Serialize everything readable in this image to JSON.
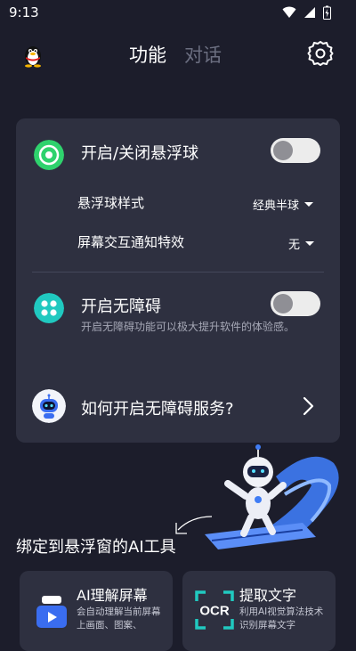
{
  "status_bar": {
    "time": "9:13"
  },
  "header": {
    "tab_active": "功能",
    "tab_inactive": "对话"
  },
  "floating_ball": {
    "title": "开启/关闭悬浮球",
    "enabled": false,
    "style_label": "悬浮球样式",
    "style_value": "经典半球",
    "effect_label": "屏幕交互通知特效",
    "effect_value": "无"
  },
  "accessibility": {
    "title": "开启无障碍",
    "enabled": false,
    "description": "开启无障碍功能可以极大提升软件的体验感。"
  },
  "how_to": {
    "label": "如何开启无障碍服务?"
  },
  "ai_tools": {
    "section_title": "绑定到悬浮窗的AI工具",
    "items": [
      {
        "title": "AI理解屏幕",
        "description": "会自动理解当前屏幕上画面、图案、"
      },
      {
        "title": "提取文字",
        "description": "利用AI视觉算法技术识别屏幕文字",
        "icon_text": "OCR"
      }
    ]
  },
  "colors": {
    "background": "#1c1d2b",
    "card": "#2e3040",
    "accent_green": "#2fd26d",
    "accent_teal": "#20c9c0",
    "accent_blue": "#3a6df0"
  }
}
